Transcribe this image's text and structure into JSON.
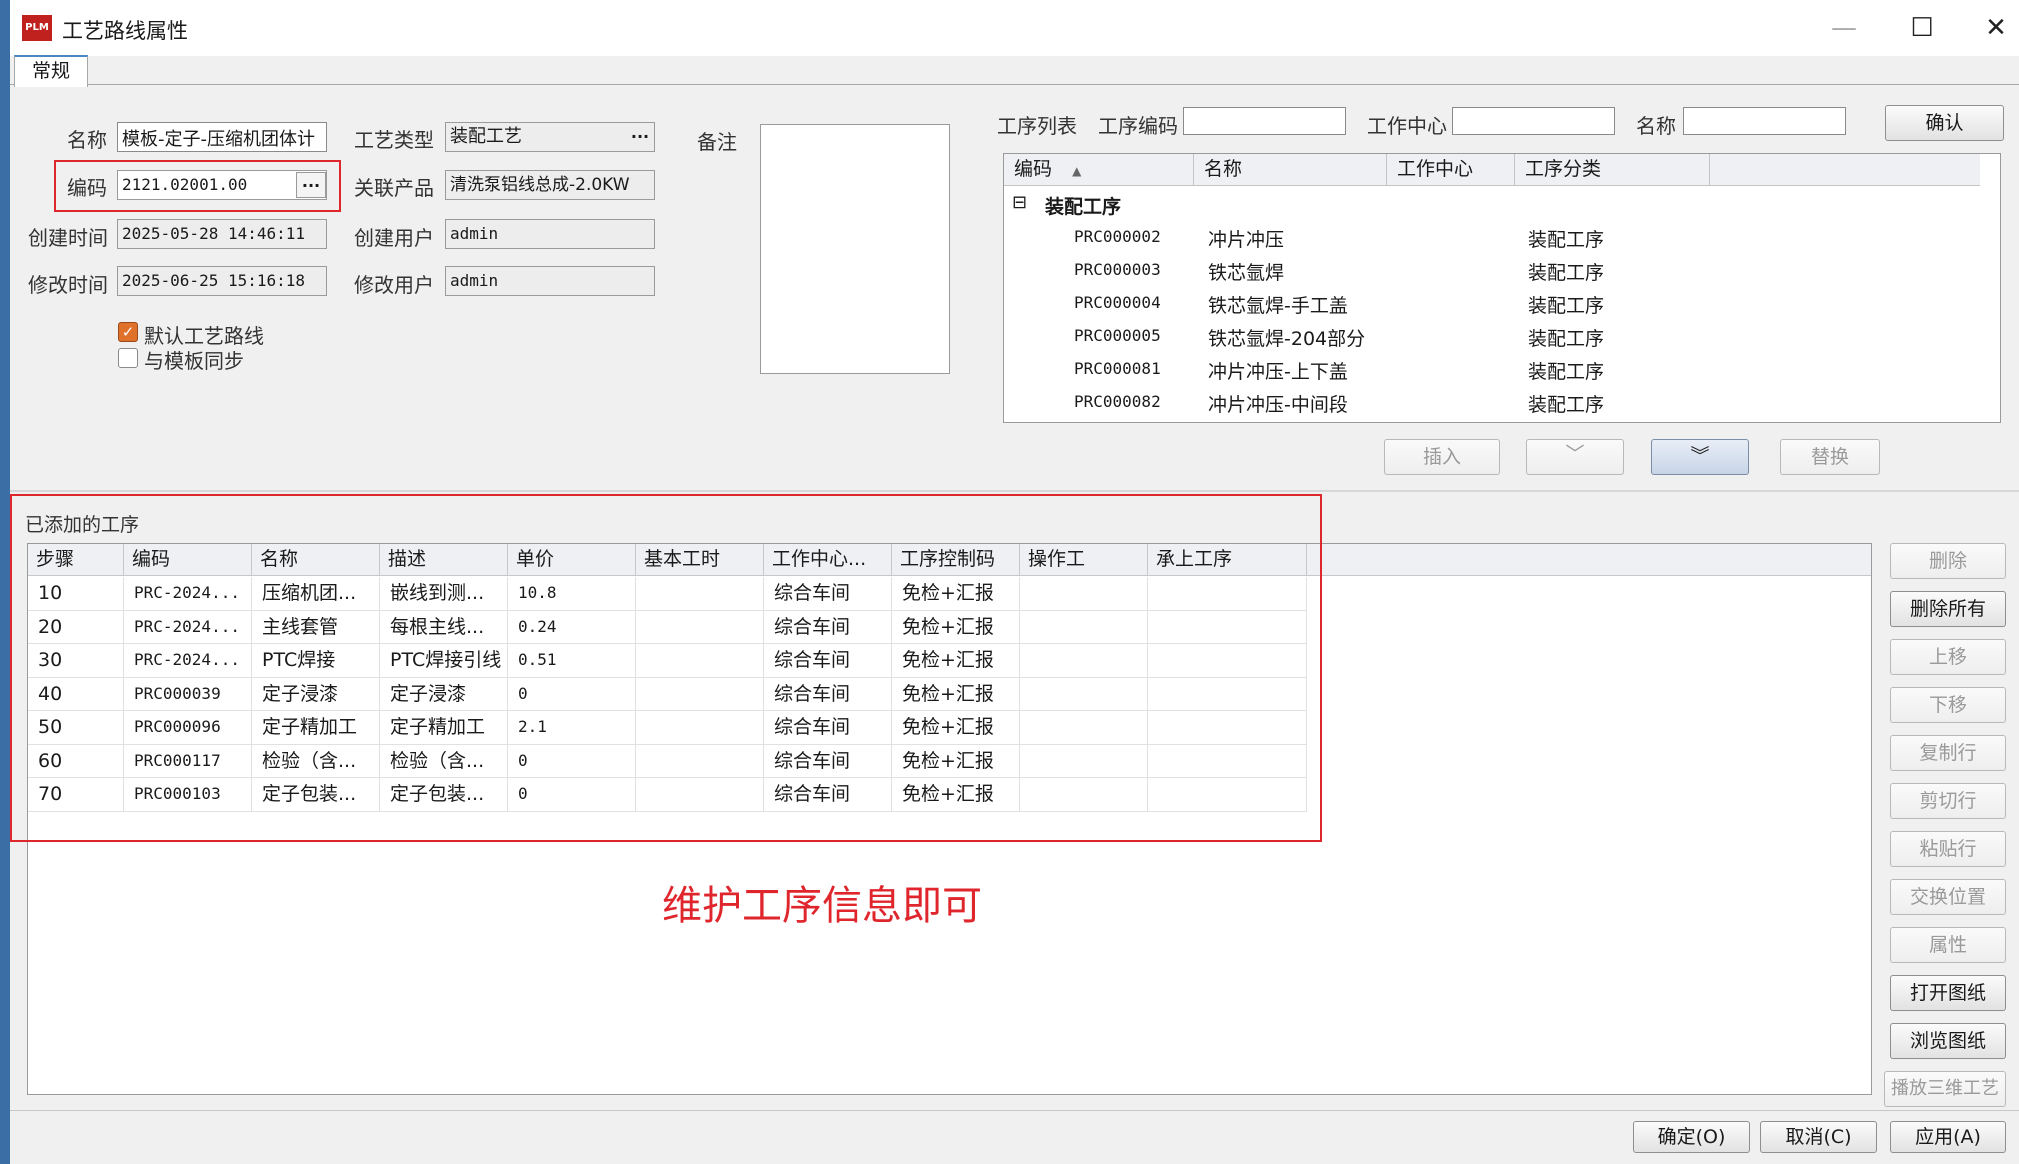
{
  "window": {
    "logo_text": "PLM",
    "title": "工艺路线属性",
    "minimize": "—",
    "maximize": "☐",
    "close": "✕",
    "tab": "常规"
  },
  "form": {
    "name_label": "名称",
    "name_value": "模板-定子-压缩机团体计",
    "code_label": "编码",
    "code_value": "2121.02001.00",
    "created_time_label": "创建时间",
    "created_time_value": "2025-05-28 14:46:11",
    "modified_time_label": "修改时间",
    "modified_time_value": "2025-06-25 15:16:18",
    "process_type_label": "工艺类型",
    "process_type_value": "装配工艺",
    "linked_product_label": "关联产品",
    "linked_product_value": "清洗泵铝线总成-2.0KW",
    "created_user_label": "创建用户",
    "created_user_value": "admin",
    "modified_user_label": "修改用户",
    "modified_user_value": "admin",
    "remark_label": "备注",
    "remark_value": "",
    "default_route_label": "默认工艺路线",
    "default_route_checked": true,
    "sync_template_label": "与模板同步",
    "sync_template_checked": false,
    "ellipsis": "..."
  },
  "search": {
    "list_label": "工序列表",
    "code_label": "工序编码",
    "code_value": "",
    "center_label": "工作中心",
    "center_value": "",
    "name_label": "名称",
    "name_value": "",
    "confirm_button": "确认"
  },
  "tree": {
    "headers": [
      "编码",
      "名称",
      "工作中心",
      "工序分类"
    ],
    "sort_icon": "▲",
    "group_label": "装配工序",
    "group_toggle": "⊟",
    "rows": [
      {
        "code": "PRC000002",
        "name": "冲片冲压",
        "center": "",
        "category": "装配工序"
      },
      {
        "code": "PRC000003",
        "name": "铁芯氩焊",
        "center": "",
        "category": "装配工序"
      },
      {
        "code": "PRC000004",
        "name": "铁芯氩焊-手工盖",
        "center": "",
        "category": "装配工序"
      },
      {
        "code": "PRC000005",
        "name": "铁芯氩焊-204部分",
        "center": "",
        "category": "装配工序"
      },
      {
        "code": "PRC000081",
        "name": "冲片冲压-上下盖",
        "center": "",
        "category": "装配工序"
      },
      {
        "code": "PRC000082",
        "name": "冲片冲压-中间段",
        "center": "",
        "category": "装配工序"
      }
    ],
    "scroll_up": "▲",
    "scroll_down": "▼"
  },
  "tree_actions": {
    "insert": "插入",
    "down_one": "﹀",
    "down_double": "︾",
    "replace": "替换"
  },
  "added": {
    "title": "已添加的工序",
    "headers": [
      "步骤",
      "编码",
      "名称",
      "描述",
      "单价",
      "基本工时",
      "工作中心...",
      "工序控制码",
      "操作工",
      "承上工序"
    ],
    "rows": [
      {
        "step": "10",
        "code": "PRC-2024...",
        "name": "压缩机团...",
        "desc": "嵌线到测...",
        "price": "10.8",
        "hours": "",
        "center": "综合车间",
        "control": "免检+汇报",
        "operator": "",
        "prev": ""
      },
      {
        "step": "20",
        "code": "PRC-2024...",
        "name": "主线套管",
        "desc": "每根主线...",
        "price": "0.24",
        "hours": "",
        "center": "综合车间",
        "control": "免检+汇报",
        "operator": "",
        "prev": ""
      },
      {
        "step": "30",
        "code": "PRC-2024...",
        "name": "PTC焊接",
        "desc": "PTC焊接引线",
        "price": "0.51",
        "hours": "",
        "center": "综合车间",
        "control": "免检+汇报",
        "operator": "",
        "prev": ""
      },
      {
        "step": "40",
        "code": "PRC000039",
        "name": "定子浸漆",
        "desc": "定子浸漆",
        "price": "0",
        "hours": "",
        "center": "综合车间",
        "control": "免检+汇报",
        "operator": "",
        "prev": ""
      },
      {
        "step": "50",
        "code": "PRC000096",
        "name": "定子精加工",
        "desc": "定子精加工",
        "price": "2.1",
        "hours": "",
        "center": "综合车间",
        "control": "免检+汇报",
        "operator": "",
        "prev": ""
      },
      {
        "step": "60",
        "code": "PRC000117",
        "name": "检验（含...",
        "desc": "检验（含...",
        "price": "0",
        "hours": "",
        "center": "综合车间",
        "control": "免检+汇报",
        "operator": "",
        "prev": ""
      },
      {
        "step": "70",
        "code": "PRC000103",
        "name": "定子包装...",
        "desc": "定子包装...",
        "price": "0",
        "hours": "",
        "center": "综合车间",
        "control": "免检+汇报",
        "operator": "",
        "prev": ""
      }
    ]
  },
  "annotation": "维护工序信息即可",
  "side_buttons": [
    {
      "label": "删除",
      "enabled": false
    },
    {
      "label": "删除所有",
      "enabled": true
    },
    {
      "label": "上移",
      "enabled": false
    },
    {
      "label": "下移",
      "enabled": false
    },
    {
      "label": "复制行",
      "enabled": false
    },
    {
      "label": "剪切行",
      "enabled": false
    },
    {
      "label": "粘贴行",
      "enabled": false
    },
    {
      "label": "交换位置",
      "enabled": false
    },
    {
      "label": "属性",
      "enabled": false
    },
    {
      "label": "打开图纸",
      "enabled": true
    },
    {
      "label": "浏览图纸",
      "enabled": true
    },
    {
      "label": "播放三维工艺",
      "enabled": false
    }
  ],
  "footer": {
    "ok": "确定(O)",
    "cancel": "取消(C)",
    "apply": "应用(A)"
  },
  "colors": {
    "annotation_red": "#e0262d",
    "logo_red": "#c0211f",
    "checkbox_orange": "#e0712a"
  }
}
